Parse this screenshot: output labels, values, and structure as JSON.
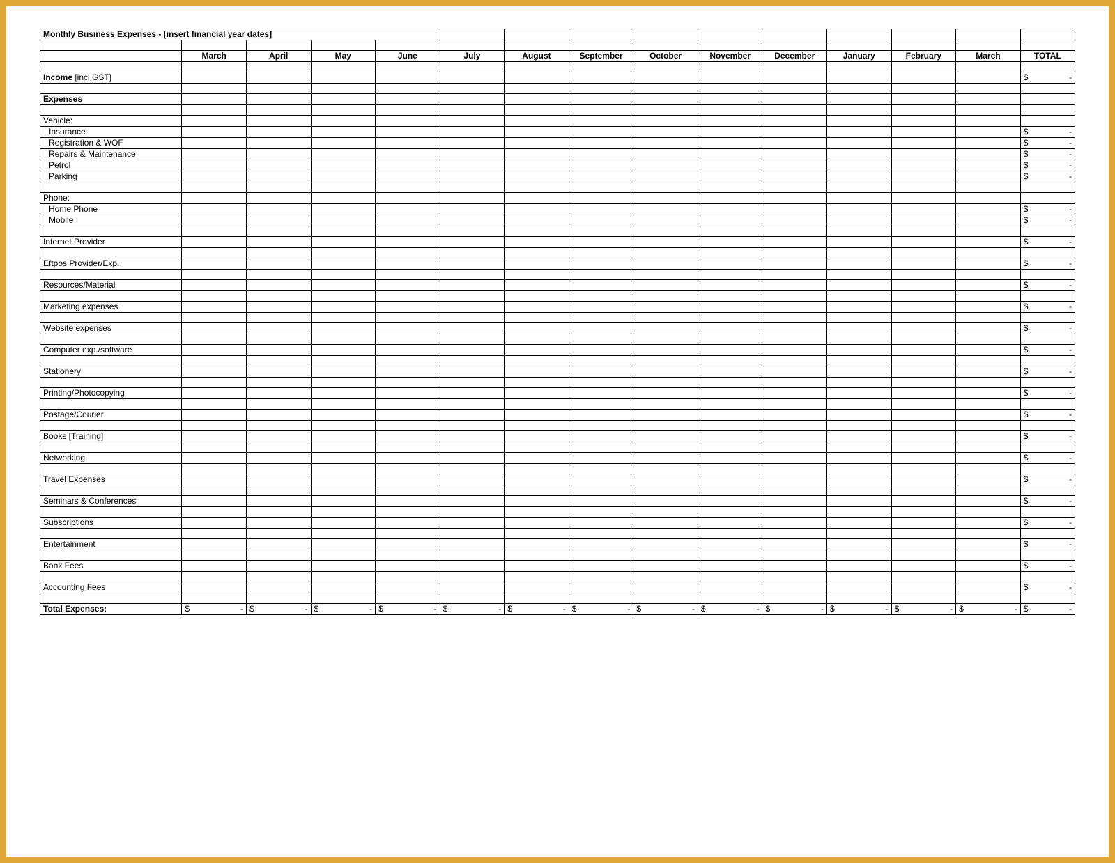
{
  "title": "Monthly Business Expenses - [insert financial year dates]",
  "months": [
    "March",
    "April",
    "May",
    "June",
    "July",
    "August",
    "September",
    "October",
    "November",
    "December",
    "January",
    "February",
    "March"
  ],
  "total_label": "TOTAL",
  "currency": "$",
  "dash": "-",
  "rows": [
    {
      "type": "blank"
    },
    {
      "type": "label",
      "text": "Income [incl.GST]",
      "bold_prefix": "Income",
      "suffix": " [incl.GST]",
      "total": true
    },
    {
      "type": "blank"
    },
    {
      "type": "label",
      "text": "Expenses",
      "bold": true
    },
    {
      "type": "blank"
    },
    {
      "type": "label",
      "text": "Vehicle:"
    },
    {
      "type": "label",
      "text": "Insurance",
      "indent": true,
      "total": true
    },
    {
      "type": "label",
      "text": "Registration & WOF",
      "indent": true,
      "total": true
    },
    {
      "type": "label",
      "text": "Repairs & Maintenance",
      "indent": true,
      "total": true
    },
    {
      "type": "label",
      "text": "Petrol",
      "indent": true,
      "total": true
    },
    {
      "type": "label",
      "text": "Parking",
      "indent": true,
      "total": true
    },
    {
      "type": "blank"
    },
    {
      "type": "label",
      "text": "Phone:"
    },
    {
      "type": "label",
      "text": "Home Phone",
      "indent": true,
      "total": true
    },
    {
      "type": "label",
      "text": "Mobile",
      "indent": true,
      "total": true
    },
    {
      "type": "blank"
    },
    {
      "type": "label",
      "text": "Internet Provider",
      "total": true
    },
    {
      "type": "blank"
    },
    {
      "type": "label",
      "text": "Eftpos Provider/Exp.",
      "total": true
    },
    {
      "type": "blank"
    },
    {
      "type": "label",
      "text": "Resources/Material",
      "total": true
    },
    {
      "type": "blank"
    },
    {
      "type": "label",
      "text": "Marketing expenses",
      "total": true
    },
    {
      "type": "blank"
    },
    {
      "type": "label",
      "text": "Website expenses",
      "total": true
    },
    {
      "type": "blank"
    },
    {
      "type": "label",
      "text": "Computer exp./software",
      "total": true
    },
    {
      "type": "blank"
    },
    {
      "type": "label",
      "text": "Stationery",
      "total": true
    },
    {
      "type": "blank"
    },
    {
      "type": "label",
      "text": "Printing/Photocopying",
      "total": true
    },
    {
      "type": "blank"
    },
    {
      "type": "label",
      "text": "Postage/Courier",
      "total": true
    },
    {
      "type": "blank"
    },
    {
      "type": "label",
      "text": "Books [Training]",
      "total": true
    },
    {
      "type": "blank"
    },
    {
      "type": "label",
      "text": "Networking",
      "total": true
    },
    {
      "type": "blank"
    },
    {
      "type": "label",
      "text": "Travel Expenses",
      "total": true
    },
    {
      "type": "blank"
    },
    {
      "type": "label",
      "text": "Seminars & Conferences",
      "total": true
    },
    {
      "type": "blank"
    },
    {
      "type": "label",
      "text": "Subscriptions",
      "total": true
    },
    {
      "type": "blank"
    },
    {
      "type": "label",
      "text": "Entertainment",
      "total": true
    },
    {
      "type": "blank"
    },
    {
      "type": "label",
      "text": "Bank Fees",
      "total": true
    },
    {
      "type": "blank"
    },
    {
      "type": "label",
      "text": "Accounting Fees",
      "total": true
    },
    {
      "type": "blank"
    }
  ],
  "total_expenses_label": "Total Expenses:"
}
